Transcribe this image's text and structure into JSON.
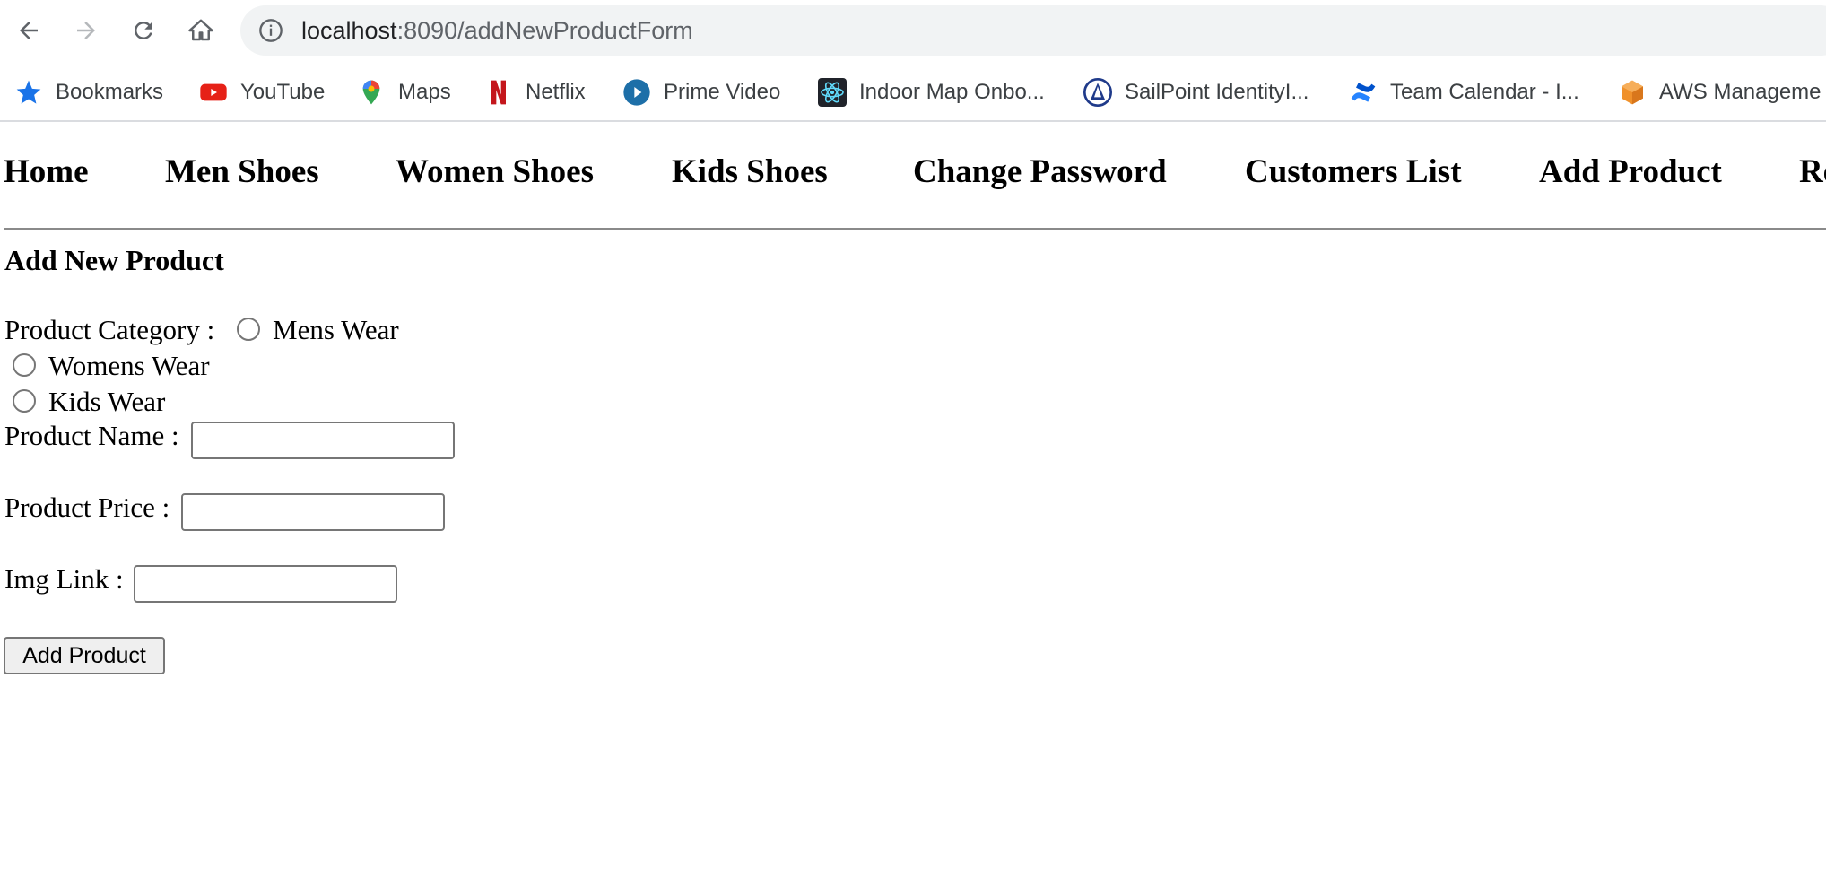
{
  "browser": {
    "address": {
      "host": "localhost",
      "path": ":8090/addNewProductForm"
    },
    "bookmarks": [
      {
        "label": "Bookmarks",
        "icon": "star-icon"
      },
      {
        "label": "YouTube",
        "icon": "youtube-icon"
      },
      {
        "label": "Maps",
        "icon": "maps-pin-icon"
      },
      {
        "label": "Netflix",
        "icon": "netflix-icon"
      },
      {
        "label": "Prime Video",
        "icon": "prime-video-icon"
      },
      {
        "label": "Indoor Map Onbo...",
        "icon": "react-atom-icon"
      },
      {
        "label": "SailPoint IdentityI...",
        "icon": "sailpoint-icon"
      },
      {
        "label": "Team Calendar - I...",
        "icon": "confluence-icon"
      },
      {
        "label": "AWS Manageme",
        "icon": "aws-cube-icon"
      }
    ]
  },
  "nav": {
    "items": [
      "Home",
      "Men Shoes",
      "Women Shoes",
      "Kids Shoes",
      "Change Password",
      "Customers List",
      "Add Product",
      "Re"
    ]
  },
  "form": {
    "title": "Add New Product",
    "category_label": "Product Category :",
    "category_options": [
      "Mens Wear",
      "Womens Wear",
      "Kids Wear"
    ],
    "name_label": "Product Name :",
    "name_value": "",
    "price_label": "Product Price :",
    "price_value": "",
    "img_label": "Img Link :",
    "img_value": "",
    "submit_label": "Add Product"
  },
  "colors": {
    "star": "#1a73e8",
    "youtube": "#e62117",
    "netflix": "#c4161c",
    "aws": "#f0912b",
    "confluence": "#2684ff"
  }
}
